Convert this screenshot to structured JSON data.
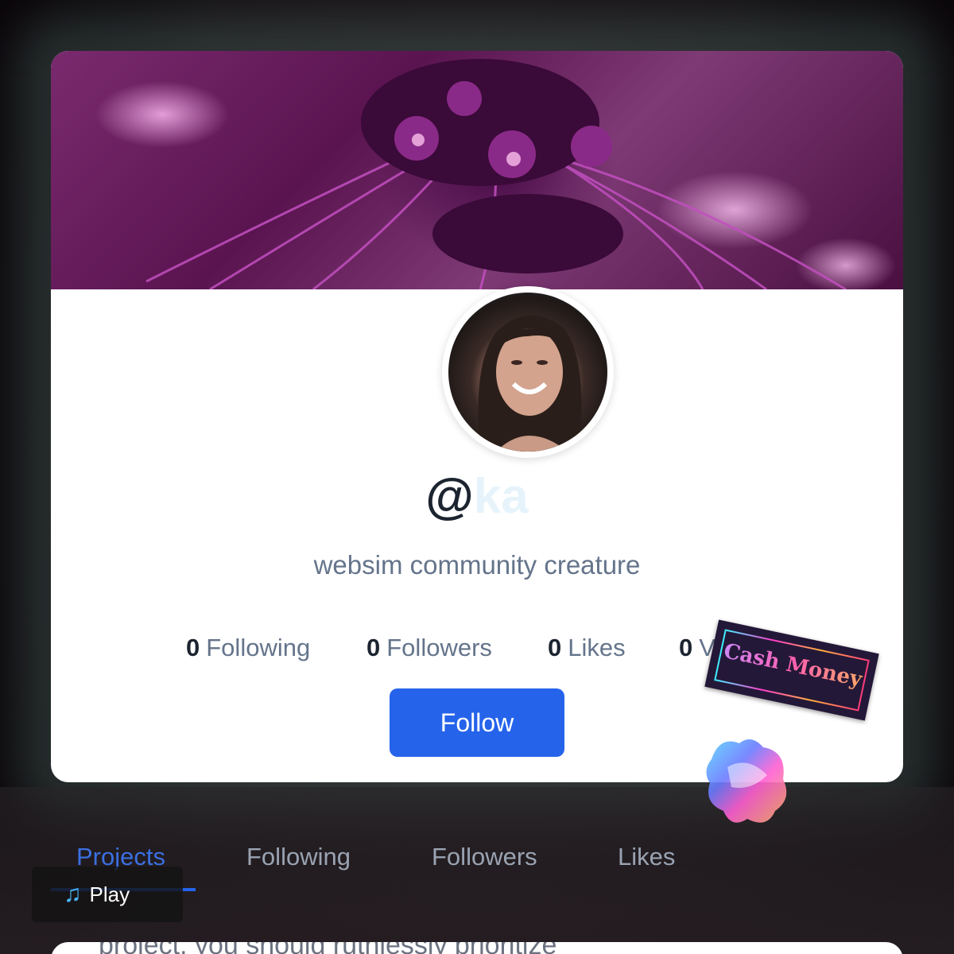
{
  "profile": {
    "username_prefix": "@",
    "username_visible": "ka",
    "bio": "websim community creature",
    "follow_label": "Follow"
  },
  "stats": [
    {
      "count": "0",
      "label": "Following"
    },
    {
      "count": "0",
      "label": "Followers"
    },
    {
      "count": "0",
      "label": "Likes"
    },
    {
      "count": "0",
      "label": "V"
    }
  ],
  "tabs": [
    {
      "label": "Projects",
      "active": true
    },
    {
      "label": "Following",
      "active": false
    },
    {
      "label": "Followers",
      "active": false
    },
    {
      "label": "Likes",
      "active": false
    }
  ],
  "stickers": {
    "cash_money": "Cash Money"
  },
  "player": {
    "icon": "music-note-icon",
    "label": "Play"
  },
  "next_card": {
    "snippet": "project, you should ruthlessly prioritize"
  },
  "colors": {
    "accent": "#2563eb",
    "text_dark": "#1c2430",
    "text_muted": "#64748b"
  }
}
